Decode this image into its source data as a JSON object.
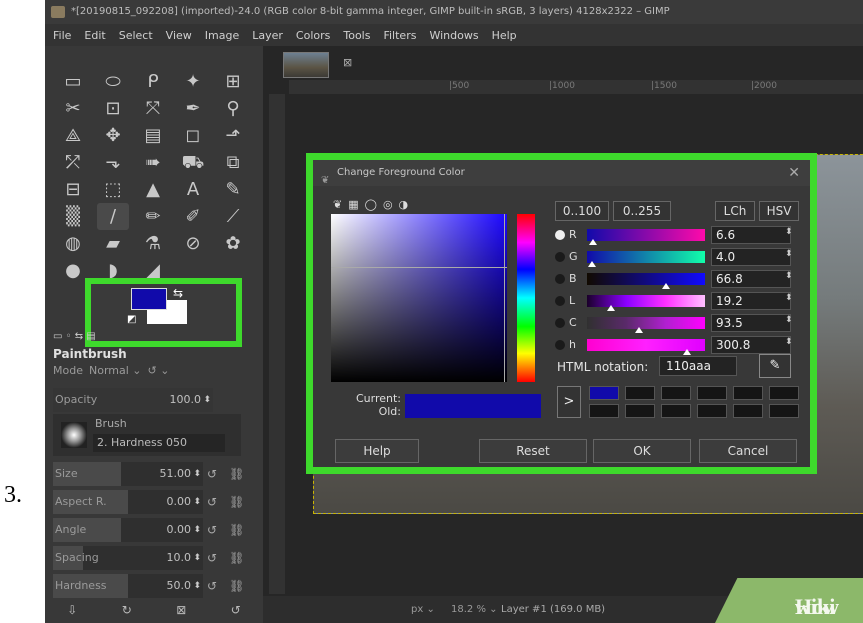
{
  "step_number": "3.",
  "window": {
    "title": "*[20190815_092208] (imported)-24.0 (RGB color 8-bit gamma integer, GIMP built-in sRGB, 3 layers) 4128x2322 – GIMP"
  },
  "menu": [
    "File",
    "Edit",
    "Select",
    "View",
    "Image",
    "Layer",
    "Colors",
    "Tools",
    "Filters",
    "Windows",
    "Help"
  ],
  "toolbox": {
    "tools": [
      "▭",
      "⬭",
      "ᑭ",
      "✦",
      "⊞",
      "✂",
      "⊡",
      "⤧",
      "✒",
      "⚲",
      "⟁",
      "✥",
      "▤",
      "◻",
      "⬏",
      "⤱",
      "⬎",
      "➠",
      "⛟",
      "⧉",
      "⊟",
      "⬚",
      "▲",
      "A",
      "✎",
      "▒",
      "/",
      "✏",
      "✐",
      "⟋",
      "◍",
      "▰",
      "⚗",
      "⊘",
      "✿",
      "●",
      "◗",
      "◢"
    ],
    "options_title": "Paintbrush",
    "mode_label": "Mode",
    "mode_value": "Normal",
    "opacity_label": "Opacity",
    "opacity_value": "100.0",
    "brush_label": "Brush",
    "brush_name": "2. Hardness 050",
    "sliders": [
      {
        "label": "Size",
        "value": "51.00"
      },
      {
        "label": "Aspect R.",
        "value": "0.00"
      },
      {
        "label": "Angle",
        "value": "0.00"
      },
      {
        "label": "Spacing",
        "value": "10.0"
      },
      {
        "label": "Hardness",
        "value": "50.0"
      }
    ]
  },
  "ruler": {
    "labels": [
      "|500",
      "|1000",
      "|1500",
      "|2000"
    ]
  },
  "statusbar": {
    "unit": "px",
    "zoom": "18.2 %",
    "layer": "Layer #1 (169.0 MB)"
  },
  "watermark": {
    "wiki": "wiki",
    "how": "How"
  },
  "dialog": {
    "title": "Change Foreground Color",
    "mode_buttons": [
      "0..100",
      "0..255",
      "LCh",
      "HSV"
    ],
    "channels": [
      {
        "name": "R",
        "value": "6.6"
      },
      {
        "name": "G",
        "value": "4.0"
      },
      {
        "name": "B",
        "value": "66.8"
      },
      {
        "name": "L",
        "value": "19.2"
      },
      {
        "name": "C",
        "value": "93.5"
      },
      {
        "name": "h",
        "value": "300.8"
      }
    ],
    "html_label": "HTML notation:",
    "html_value": "110aaa",
    "current_label": "Current:",
    "old_label": "Old:",
    "buttons": {
      "help": "Help",
      "reset": "Reset",
      "ok": "OK",
      "cancel": "Cancel"
    }
  },
  "colors": {
    "foreground": "#110aaa",
    "background": "#ffffff",
    "highlight": "#3ed92c",
    "watermark": "#8cb86a"
  }
}
